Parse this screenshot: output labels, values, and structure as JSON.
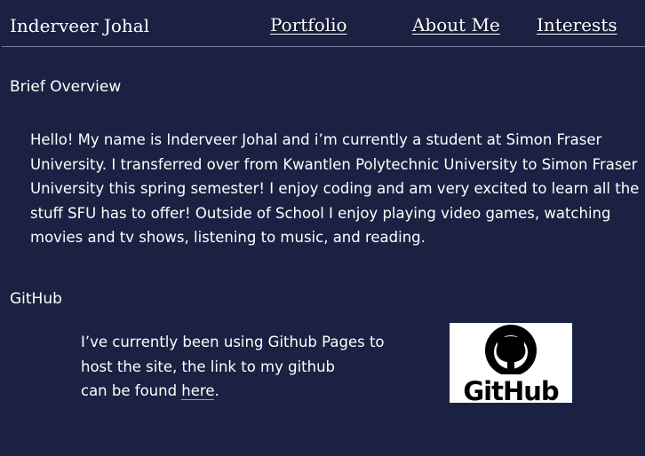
{
  "header": {
    "site_name": "Inderveer Johal",
    "nav": {
      "portfolio": "Portfolio",
      "about": "About Me",
      "interests": "Interests"
    }
  },
  "overview": {
    "title": "Brief Overview",
    "body": "Hello! My name is Inderveer Johal and i’m currently a student at Simon Fraser University. I transferred over from Kwantlen Polytechnic University to Simon Fraser University this spring semester! I enjoy coding and am very excited to learn all the stuff SFU has to offer! Outside of School I enjoy playing video games, watching movies and tv shows, listening to music, and reading."
  },
  "github": {
    "title": "GitHub",
    "line1": "I’ve currently been using Github Pages to",
    "line2": "host the site, the link to my github",
    "line3_prefix": "can be found ",
    "link_text": "here",
    "line3_suffix": ".",
    "logo_text": "GitHub",
    "logo_icon": "github-octocat-icon"
  },
  "colors": {
    "background": "#1b2142",
    "text": "#ffffff",
    "rule": "#7a7f99"
  }
}
